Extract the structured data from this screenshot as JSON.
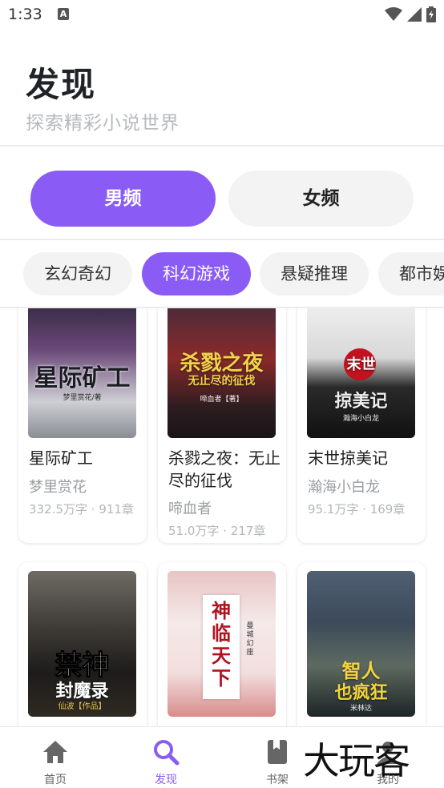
{
  "status_bar": {
    "time": "1:33",
    "notification_icon": "A"
  },
  "header": {
    "title": "发现",
    "subtitle": "探索精彩小说世界"
  },
  "gender_tabs": [
    {
      "label": "男频",
      "active": true
    },
    {
      "label": "女频",
      "active": false
    }
  ],
  "categories": [
    {
      "label": "玄幻奇幻",
      "active": false
    },
    {
      "label": "科幻游戏",
      "active": true
    },
    {
      "label": "悬疑推理",
      "active": false
    },
    {
      "label": "都市娱",
      "active": false
    }
  ],
  "books": [
    {
      "title": "星际矿工",
      "author": "梦里赏花",
      "meta": "332.5万字 · 911章",
      "cover_title": "星际矿工",
      "cover_author": "梦里赏花/著"
    },
    {
      "title": "杀戮之夜：无止尽的征伐",
      "author": "啼血者",
      "meta": "51.0万字 · 217章",
      "cover_title": "杀戮之夜",
      "cover_title2": "无止尽的征伐",
      "cover_author": "啼血者【著】"
    },
    {
      "title": "末世掠美记",
      "author": "瀚海小白龙",
      "meta": "95.1万字 · 169章",
      "cover_title": "末世",
      "cover_title2": "掠美记",
      "cover_author": "瀚海小白龙"
    },
    {
      "cover_title": "禁神",
      "cover_title2": "封魔录",
      "cover_author": "仙波【作品】"
    },
    {
      "cover_title": "神临天下",
      "cover_author": "曼城幻座"
    },
    {
      "cover_title": "智人",
      "cover_title2": "也疯狂",
      "cover_author": "米林达"
    }
  ],
  "bottom_nav": [
    {
      "label": "首页",
      "icon": "home-icon",
      "active": false
    },
    {
      "label": "发现",
      "icon": "search-icon",
      "active": true
    },
    {
      "label": "书架",
      "icon": "bookshelf-icon",
      "active": false
    },
    {
      "label": "我的",
      "icon": "profile-icon",
      "active": false
    }
  ],
  "watermark": "大玩客",
  "colors": {
    "accent": "#8a5cf5",
    "chip_bg": "#f3f3f4"
  }
}
